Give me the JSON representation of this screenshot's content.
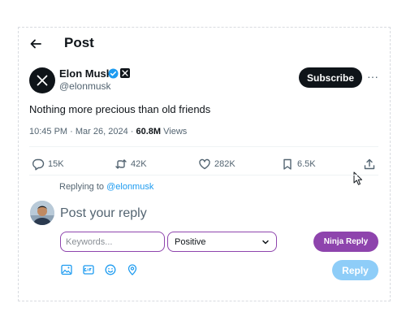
{
  "header": {
    "title": "Post"
  },
  "author": {
    "name": "Elon Musk",
    "handle": "@elonmusk",
    "subscribe_label": "Subscribe",
    "more_label": "···"
  },
  "post": {
    "text": "Nothing more precious than old friends",
    "time": "10:45 PM",
    "sep1": " · ",
    "date": "Mar 26, 2024",
    "sep2": " · ",
    "views_count": "60.8M",
    "views_label": " Views"
  },
  "actions": {
    "replies": "15K",
    "reposts": "42K",
    "likes": "282K",
    "bookmarks": "6.5K"
  },
  "reply": {
    "replying_prefix": "Replying to ",
    "replying_handle": "@elonmusk",
    "placeholder": "Post your reply",
    "button_label": "Reply"
  },
  "ninja": {
    "keywords_placeholder": "Keywords...",
    "sentiment_value": "Positive",
    "button_label": "Ninja Reply"
  },
  "colors": {
    "accent_blue": "#1d9bf0",
    "ninja_purple": "#8e44ad",
    "reply_button_disabled": "#8ecdf8"
  },
  "icons": {
    "back": "arrow-left-icon",
    "verified": "verified-badge-icon",
    "affiliate": "x-logo-icon",
    "more": "more-horizontal-icon",
    "reply": "comment-icon",
    "repost": "repost-icon",
    "like": "heart-icon",
    "bookmark": "bookmark-icon",
    "share": "share-icon",
    "image": "image-icon",
    "gif": "gif-icon",
    "emoji": "emoji-icon",
    "location": "location-icon"
  }
}
